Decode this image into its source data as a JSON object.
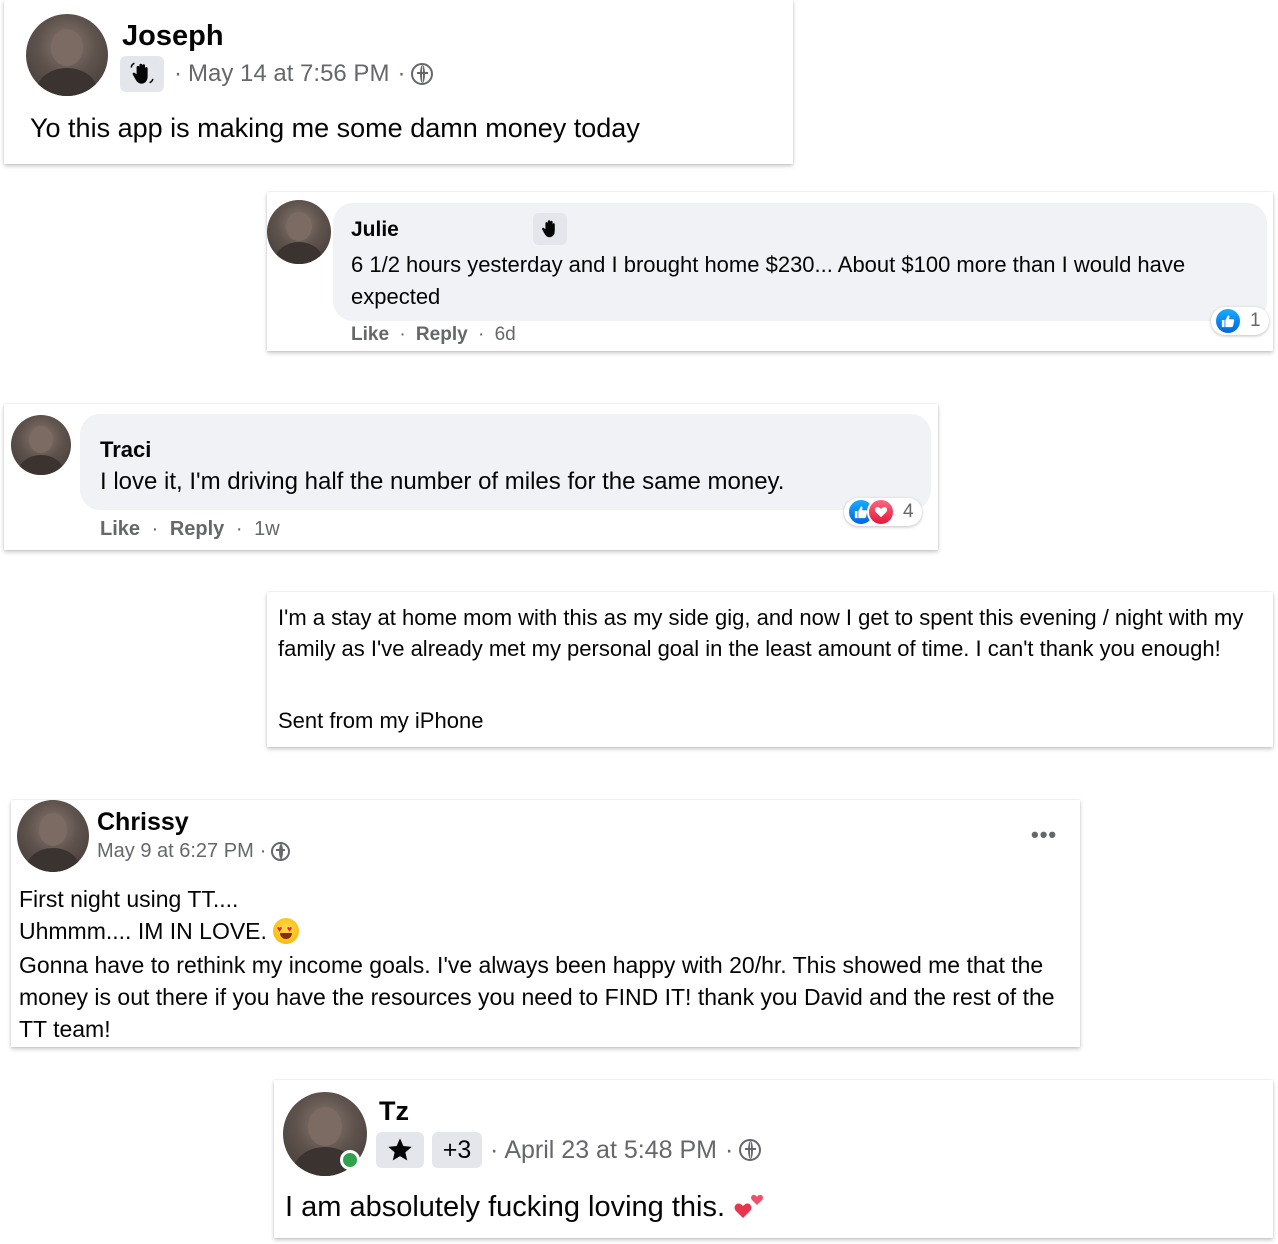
{
  "posts": {
    "joseph": {
      "name": "Joseph",
      "badge_icon": "wave-hand-icon",
      "date": "May 14 at 7:56 PM",
      "sep": "·",
      "privacy_icon": "group-icon",
      "text": "Yo this app is making me some damn money today"
    },
    "julie": {
      "name": "Julie",
      "badge_icon": "wave-hand-icon",
      "text": "6 1/2 hours yesterday and I brought home $230... About $100 more than I would have expected",
      "like_label": "Like",
      "reply_label": "Reply",
      "age": "6d",
      "sep": "·",
      "reaction_count": "1"
    },
    "traci": {
      "name": "Traci",
      "text": "I love it, I'm driving half the number of miles for the same money.",
      "like_label": "Like",
      "reply_label": "Reply",
      "age": "1w",
      "sep": "·",
      "reaction_count": "4"
    },
    "email": {
      "text": "I'm a stay at home mom with this as my side gig, and now I get to spent this evening / night with my family as I've already met my personal goal in the least amount of time. I can't thank you enough!",
      "signature": "Sent from my iPhone"
    },
    "chrissy": {
      "name": "Chrissy",
      "date": "May 9 at 6:27 PM",
      "sep": "·",
      "more_label": "•••",
      "line1": "First night using TT....",
      "line2": "Uhmmm.... IM IN LOVE.",
      "line3": "Gonna have to rethink my income goals. I've always been happy with 20/hr. This showed me that the money is out there if you have the resources you need to FIND IT! thank you David and the rest of the TT team!"
    },
    "tz": {
      "name": "Tz",
      "badge_icon": "star-icon",
      "extra_badges": "+3",
      "date": "April 23 at 5:48 PM",
      "sep": "·",
      "text": "I am absolutely fucking loving this."
    }
  },
  "colors": {
    "meta_gray": "#65676b",
    "bubble_bg": "#f0f2f5",
    "like_blue": "#0165e1",
    "love_red": "#e61739",
    "online_green": "#31a24c"
  }
}
